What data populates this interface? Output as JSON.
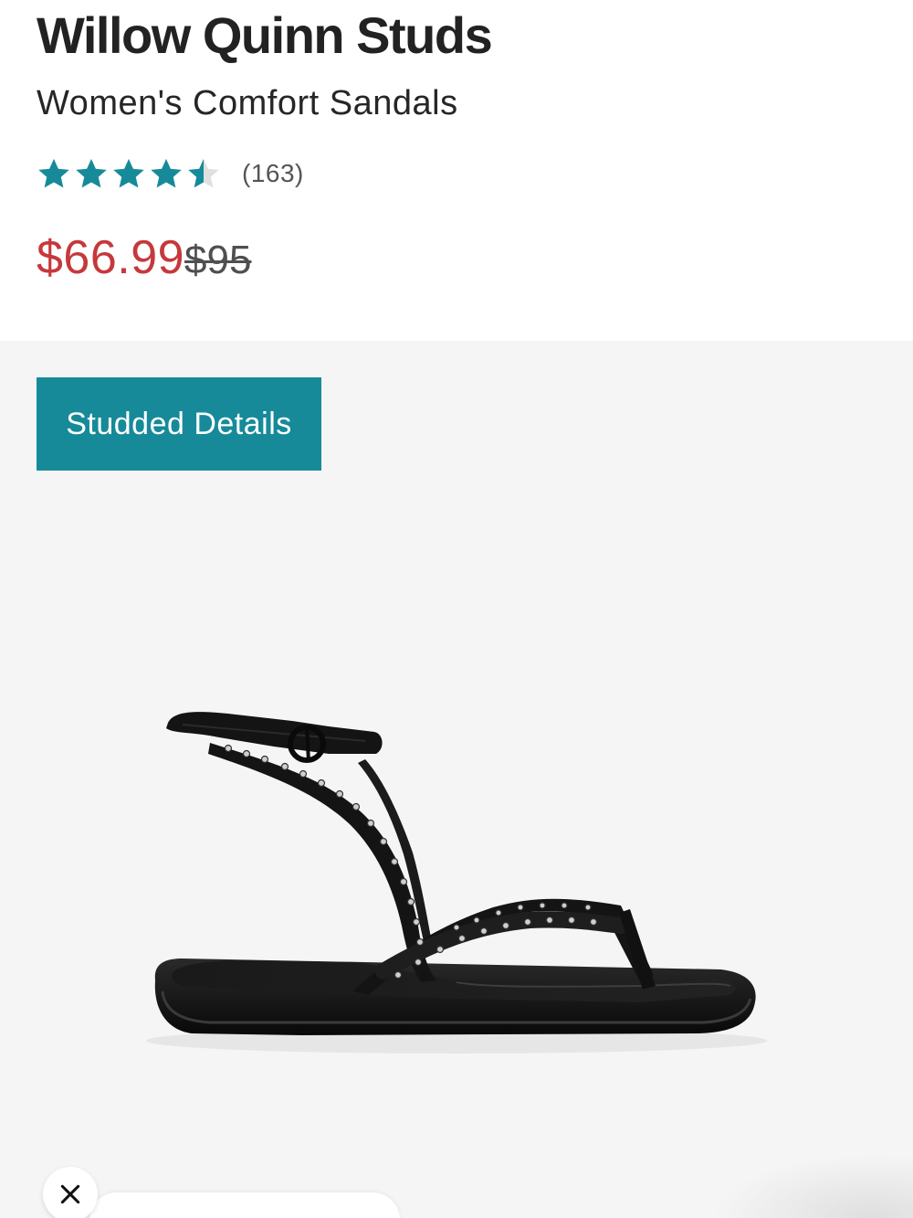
{
  "product": {
    "title": "Willow Quinn Studs",
    "subtitle": "Women's Comfort Sandals",
    "rating": {
      "value": 4.5,
      "max": 5,
      "review_count_text": "(163)",
      "star_color": "#168a99",
      "empty_star_color": "#d8d8d8"
    },
    "price": {
      "sale": "$66.99",
      "original": "$95",
      "sale_color": "#c6383b"
    }
  },
  "gallery": {
    "badge_label": "Studded Details",
    "badge_color": "#168a99",
    "background_color": "#f5f5f5",
    "image_subject": "black studded thong sandal with ankle strap",
    "controls": {
      "close_icon": "close-icon"
    }
  }
}
